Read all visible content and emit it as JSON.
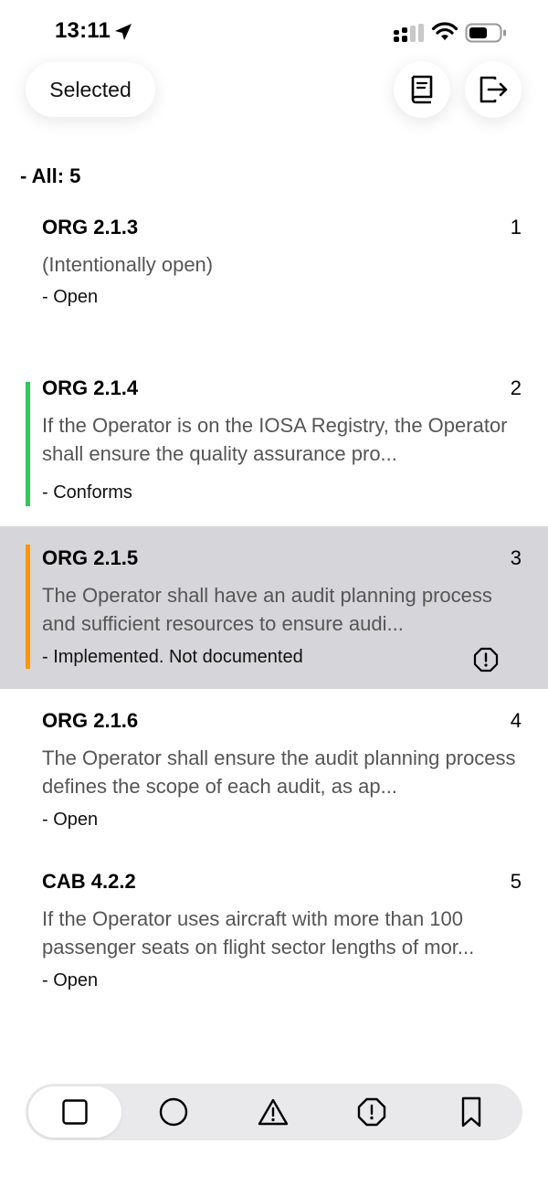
{
  "status_bar": {
    "time": "13:11",
    "icons": [
      "location-arrow-icon",
      "cellular-signal-icon",
      "wifi-icon",
      "battery-icon"
    ]
  },
  "header": {
    "selected_label": "Selected",
    "buttons": [
      "book-icon",
      "logout-icon"
    ]
  },
  "list": {
    "all_label": "- All: 5",
    "items": [
      {
        "code": "ORG 2.1.3",
        "number": "1",
        "text": "(Intentionally open)",
        "status": "- Open",
        "bar_color": "",
        "highlighted": false,
        "warning": false
      },
      {
        "code": "ORG 2.1.4",
        "number": "2",
        "text": "If the Operator is on the IOSA Registry, the Operator shall ensure the quality assurance pro...",
        "status": "- Conforms",
        "bar_color": "#34c759",
        "highlighted": false,
        "warning": false
      },
      {
        "code": "ORG 2.1.5",
        "number": "3",
        "text": "The Operator shall have an audit planning process and sufficient resources to ensure audi...",
        "status": "- Implemented. Not documented",
        "bar_color": "#ff9500",
        "highlighted": true,
        "warning": true
      },
      {
        "code": "ORG 2.1.6",
        "number": "4",
        "text": "The Operator shall ensure the audit planning process defines the scope of each audit, as ap...",
        "status": "- Open",
        "bar_color": "",
        "highlighted": false,
        "warning": false
      },
      {
        "code": "CAB 4.2.2",
        "number": "5",
        "text": "If the Operator uses aircraft with more than 100 passenger seats on flight sector lengths of mor...",
        "status": "- Open",
        "bar_color": "",
        "highlighted": false,
        "warning": false
      }
    ]
  },
  "tab_bar": {
    "tabs": [
      "square-icon",
      "circle-icon",
      "warning-triangle-icon",
      "alert-octagon-icon",
      "bookmark-icon"
    ],
    "active_index": 0
  },
  "colors": {
    "conforms": "#34c759",
    "implemented": "#ff9500",
    "highlight_bg": "#d6d6da",
    "tab_bar_bg": "#e9e9eb"
  }
}
